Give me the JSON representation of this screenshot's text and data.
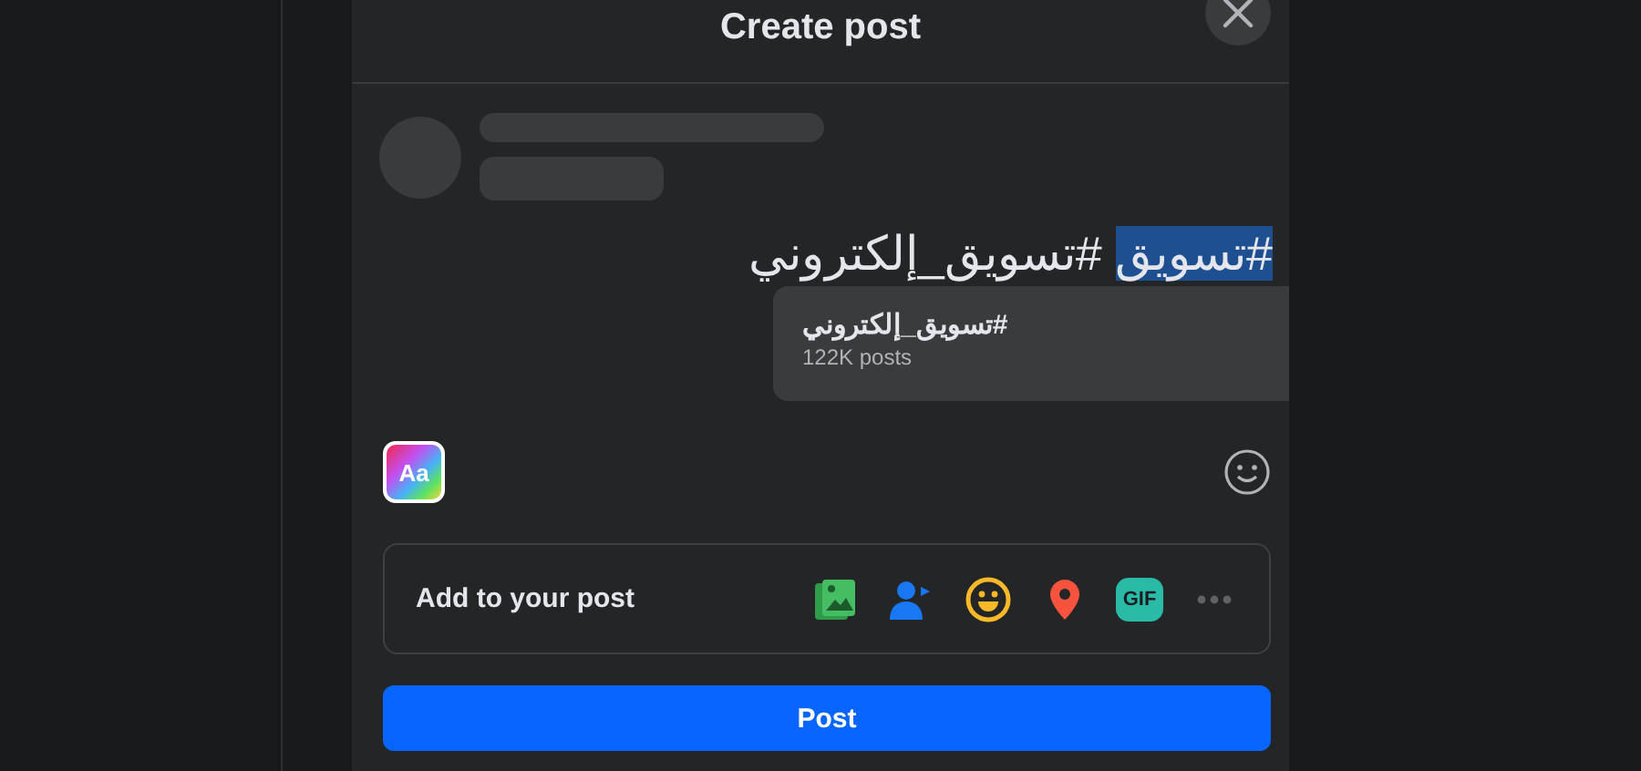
{
  "dialog": {
    "title": "Create post"
  },
  "composer": {
    "segments": [
      {
        "text": "#تسويق",
        "selected": true
      },
      {
        "text": " #تسويق_إلكتروني",
        "selected": false
      }
    ]
  },
  "suggestion": {
    "tag": "#تسويق_إلكتروني",
    "count": "122K posts"
  },
  "text_style_label": "Aa",
  "add_to_post": {
    "label": "Add to your post",
    "gif_label": "GIF"
  },
  "post_button": "Post"
}
